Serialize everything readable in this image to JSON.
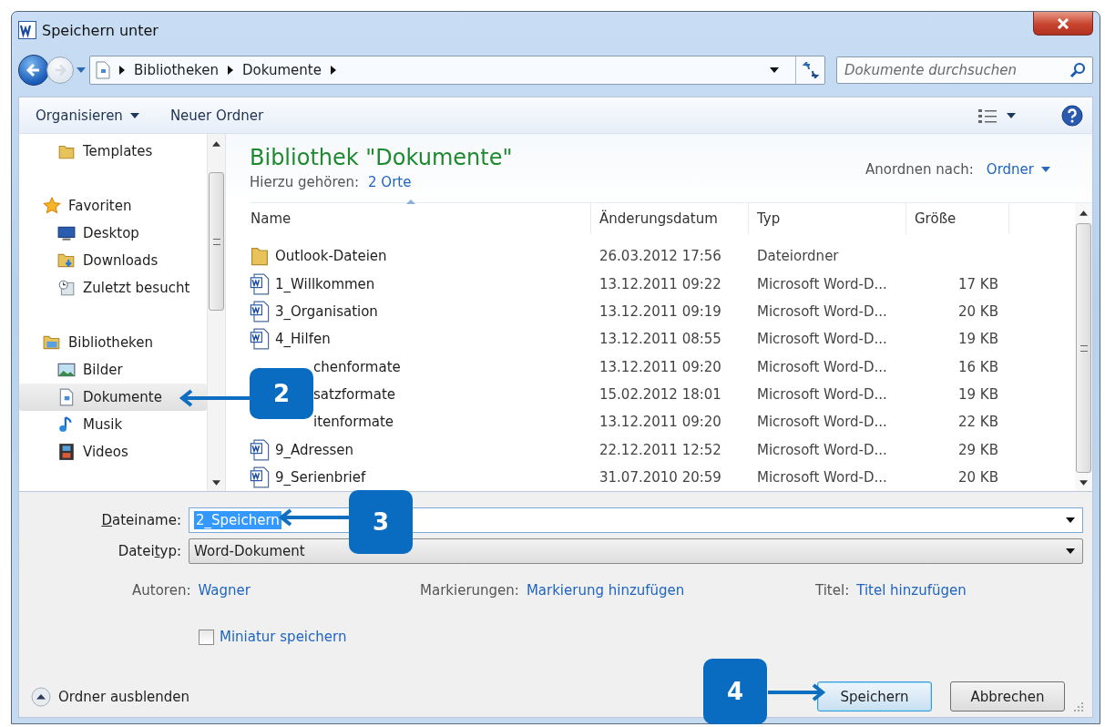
{
  "window": {
    "title": "Speichern unter"
  },
  "address_bar": {
    "crumbs": [
      "Bibliotheken",
      "Dokumente"
    ]
  },
  "search": {
    "placeholder": "Dokumente durchsuchen"
  },
  "toolbar": {
    "organize": "Organisieren",
    "new_folder": "Neuer Ordner"
  },
  "nav_tree": [
    {
      "children": [
        {
          "label": "Templates",
          "kind": "folder",
          "selected": false
        }
      ]
    },
    {
      "label": "Favoriten",
      "kind": "star",
      "selected": false,
      "children": [
        {
          "label": "Desktop",
          "kind": "desktop",
          "selected": false
        },
        {
          "label": "Downloads",
          "kind": "downloads",
          "selected": false
        },
        {
          "label": "Zuletzt besucht",
          "kind": "recent",
          "selected": false
        }
      ]
    },
    {
      "label": "Bibliotheken",
      "kind": "library",
      "selected": false,
      "children": [
        {
          "label": "Bilder",
          "kind": "pictures",
          "selected": false
        },
        {
          "label": "Dokumente",
          "kind": "documents",
          "selected": true
        },
        {
          "label": "Musik",
          "kind": "music",
          "selected": false
        },
        {
          "label": "Videos",
          "kind": "videos",
          "selected": false
        }
      ]
    }
  ],
  "library": {
    "title": "Bibliothek \"Dokumente\"",
    "includes_label": "Hierzu gehören:",
    "includes_link": "2 Orte",
    "arrange_label": "Anordnen nach:",
    "arrange_value": "Ordner"
  },
  "table": {
    "columns": [
      "Name",
      "Änderungsdatum",
      "Typ",
      "Größe"
    ],
    "rows": [
      {
        "kind": "folder",
        "name": "Outlook-Dateien",
        "date": "26.03.2012 17:56",
        "type": "Dateiordner",
        "size": ""
      },
      {
        "kind": "word",
        "name": "1_Willkommen",
        "date": "13.12.2011 09:22",
        "type": "Microsoft Word-D...",
        "size": "17 KB"
      },
      {
        "kind": "word",
        "name": "3_Organisation",
        "date": "13.12.2011 09:19",
        "type": "Microsoft Word-D...",
        "size": "20 KB"
      },
      {
        "kind": "word",
        "name": "4_Hilfen",
        "date": "13.12.2011 08:55",
        "type": "Microsoft Word-D...",
        "size": "19 KB"
      },
      {
        "kind": "covered",
        "name": "chenformate",
        "date": "13.12.2011 09:20",
        "type": "Microsoft Word-D...",
        "size": "16 KB"
      },
      {
        "kind": "covered",
        "name": "satzformate",
        "date": "15.02.2012 18:01",
        "type": "Microsoft Word-D...",
        "size": "19 KB"
      },
      {
        "kind": "covered",
        "name": "itenformate",
        "date": "13.12.2011 09:20",
        "type": "Microsoft Word-D...",
        "size": "22 KB"
      },
      {
        "kind": "word",
        "name": "9_Adressen",
        "date": "22.12.2011 12:52",
        "type": "Microsoft Word-D...",
        "size": "29 KB"
      },
      {
        "kind": "word",
        "name": "9_Serienbrief",
        "date": "31.07.2010 20:59",
        "type": "Microsoft Word-D...",
        "size": "20 KB"
      }
    ]
  },
  "filename": {
    "label": {
      "key": "D",
      "after": "ateiname:"
    },
    "value": "2_Speichern",
    "text_selected": true
  },
  "filetype": {
    "label": {
      "before": "Datei",
      "key": "t",
      "after": "yp:"
    },
    "value": "Word-Dokument"
  },
  "metadata": [
    {
      "label": "Autoren:",
      "value": "Wagner"
    },
    {
      "label": "Markierungen:",
      "value": "Markierung hinzufügen"
    },
    {
      "label": "Titel:",
      "value": "Titel hinzufügen"
    }
  ],
  "thumbnail_checkbox": {
    "label": "Miniatur speichern",
    "checked": false
  },
  "hide_folders": "Ordner ausblenden",
  "buttons": [
    {
      "label": "Speichern",
      "default": true
    },
    {
      "label": "Abbrechen",
      "default": false
    }
  ],
  "callouts": [
    {
      "number": "2"
    },
    {
      "number": "3"
    },
    {
      "number": "4"
    }
  ]
}
